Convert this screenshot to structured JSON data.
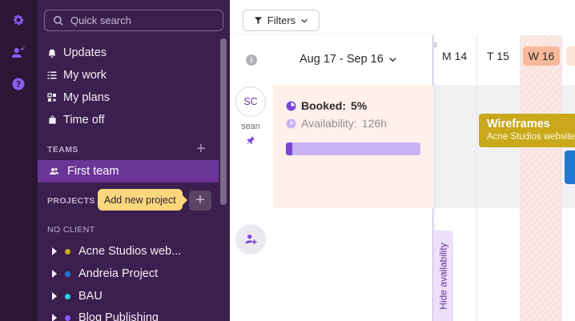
{
  "rail": {
    "icons": [
      "gear-icon",
      "people-icon",
      "help-icon"
    ],
    "accent": "#8b5cf6"
  },
  "sidebar": {
    "search_placeholder": "Quick search",
    "nav": [
      {
        "label": "Updates",
        "icon": "bell-icon"
      },
      {
        "label": "My work",
        "icon": "list-icon"
      },
      {
        "label": "My plans",
        "icon": "plans-icon"
      },
      {
        "label": "Time off",
        "icon": "bag-icon"
      }
    ],
    "teams_label": "TEAMS",
    "team": "First team",
    "projects_label": "PROJECTS",
    "add_project_tooltip": "Add new project",
    "no_client_label": "NO CLIENT",
    "projects": [
      {
        "label": "Acne Studios web...",
        "color": "#c9a81b"
      },
      {
        "label": "Andreia Project",
        "color": "#1f77d0"
      },
      {
        "label": "BAU",
        "color": "#2fd3e6"
      },
      {
        "label": "Blog Publishing",
        "color": "#8b5cf6"
      }
    ]
  },
  "main": {
    "filters_label": "Filters",
    "date_range": "Aug 17 - Sep 16",
    "days": [
      {
        "label": "M 14"
      },
      {
        "label": "T 15"
      },
      {
        "label": "W 16",
        "today": true
      }
    ],
    "tiny_num": "3",
    "user": {
      "initials": "SC",
      "name": "sean"
    },
    "booked_label": "Booked:",
    "booked_value": "5%",
    "booked_fraction": 0.05,
    "availability_label": "Availability:",
    "availability_value": "126h",
    "hide_availability": "Hide availability",
    "task": {
      "title": "Wireframes",
      "client": "Acne Studios website"
    }
  }
}
